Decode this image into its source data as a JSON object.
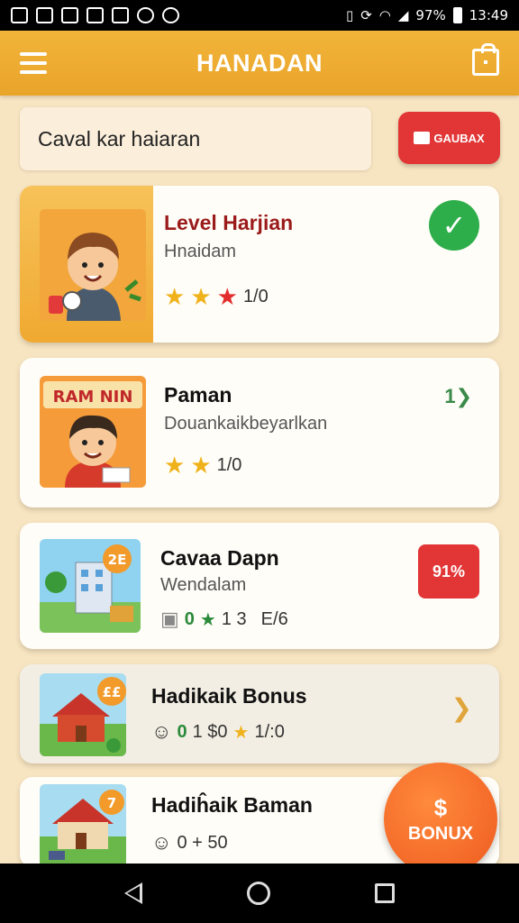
{
  "status": {
    "battery": "97%",
    "time": "13:49"
  },
  "app": {
    "title": "HANADAN"
  },
  "search": {
    "value": "Caval kar haiaran"
  },
  "action_button": {
    "label": "GAUBAX",
    "color": "#e23636"
  },
  "cards": [
    {
      "title": "Level Harjian",
      "subtitle": "Hnaidam",
      "rating": "1/0",
      "stars": [
        "gold",
        "gold",
        "red"
      ],
      "status_icon": "check-icon",
      "title_color": "#9b1b1b"
    },
    {
      "title": "Paman",
      "subtitle": "Douankaikbeyarlkan",
      "rating": "1/0",
      "stars": [
        "gold",
        "gold"
      ],
      "badge": "1",
      "thumb_text": "RAM NIN"
    },
    {
      "title": "Cavaa Dapn",
      "subtitle": "Wendalam",
      "stats": [
        "0",
        "1 3",
        "E/6"
      ],
      "badge": "2E",
      "tag": "91% "
    },
    {
      "title": "Hadikaik Bonus",
      "stats": [
        "0",
        "1 $0",
        "1/:0"
      ],
      "badge": "££"
    },
    {
      "title": "Hadiĥaik Baman",
      "stats": [
        "0 + 50"
      ],
      "badge": "7"
    }
  ],
  "fab": {
    "label": "BONUX",
    "symbol": "$"
  },
  "colors": {
    "accent": "#f2b43a",
    "background": "#f7e4c0",
    "success": "#2dae4a",
    "danger": "#e23636",
    "fab": "#ee5a1f"
  }
}
